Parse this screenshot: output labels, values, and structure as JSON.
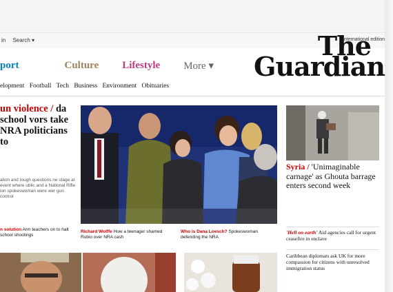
{
  "utility": {
    "links": [
      "in",
      "Search ▾"
    ],
    "edition": "International edition"
  },
  "pillars": [
    {
      "label": "port",
      "key": "sport"
    },
    {
      "label": "Culture",
      "key": "culture"
    },
    {
      "label": "Lifestyle",
      "key": "lifestyle"
    },
    {
      "label": "More ▾",
      "key": "more"
    }
  ],
  "logo": {
    "line1": "The",
    "line2": "Guardian"
  },
  "subnav": [
    "elopment",
    "Football",
    "Tech",
    "Business",
    "Environment",
    "Obituaries"
  ],
  "lead": {
    "kicker": "un violence /",
    "headline": "da school vors take NRA politicians to",
    "standfirst": "ation and tough questions ne stage at event where ublic and a National Rifle ion spokeswoman were wer gun control",
    "sub_kicker": "n solution",
    "sub_text": "Arm teachers on to halt school shootings"
  },
  "captions": [
    {
      "kicker": "Richard Wolffe",
      "text": "How a teenager shamed Rubio over NRA cash"
    },
    {
      "kicker": "Who is Dana Loesch?",
      "text": "Spokeswoman defending the NRA"
    }
  ],
  "side": {
    "kicker": "Syria /",
    "headline": "'Unimaginable carnage' as Ghouta barrage enters second week",
    "item1_kicker": "'Hell on earth'",
    "item1_text": "Aid agencies call for urgent ceasefire in enclave",
    "item2_text": "Caribbean diplomats ask UK for more compassion for citizens with unresolved immigration status"
  },
  "colors": {
    "news": "#c70000",
    "sport": "#0084c6",
    "culture": "#a1845c",
    "lifestyle": "#bb3b80"
  }
}
